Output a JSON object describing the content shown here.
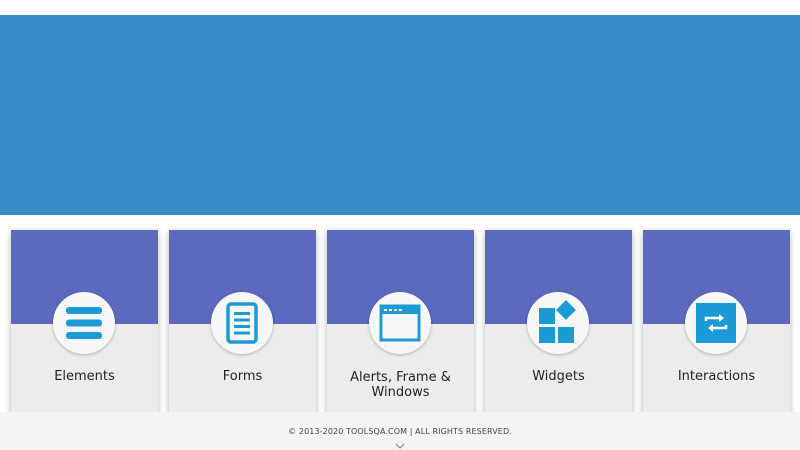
{
  "colors": {
    "banner": "#398dc6",
    "card_header": "#5b6abf",
    "card_body": "#ececec",
    "icon": "#1b9ad6",
    "footer": "#f4f4f4"
  },
  "cards": [
    {
      "label": "Elements",
      "icon": "menu-lines-icon"
    },
    {
      "label": "Forms",
      "icon": "document-icon"
    },
    {
      "label": "Alerts, Frame & Windows",
      "icon": "browser-window-icon"
    },
    {
      "label": "Widgets",
      "icon": "widgets-icon"
    },
    {
      "label": "Interactions",
      "icon": "repeat-arrows-icon"
    }
  ],
  "footer": {
    "text": "© 2013-2020 TOOLSQA.COM | ALL RIGHTS RESERVED.",
    "chevron_icon": "chevron-down-icon"
  }
}
